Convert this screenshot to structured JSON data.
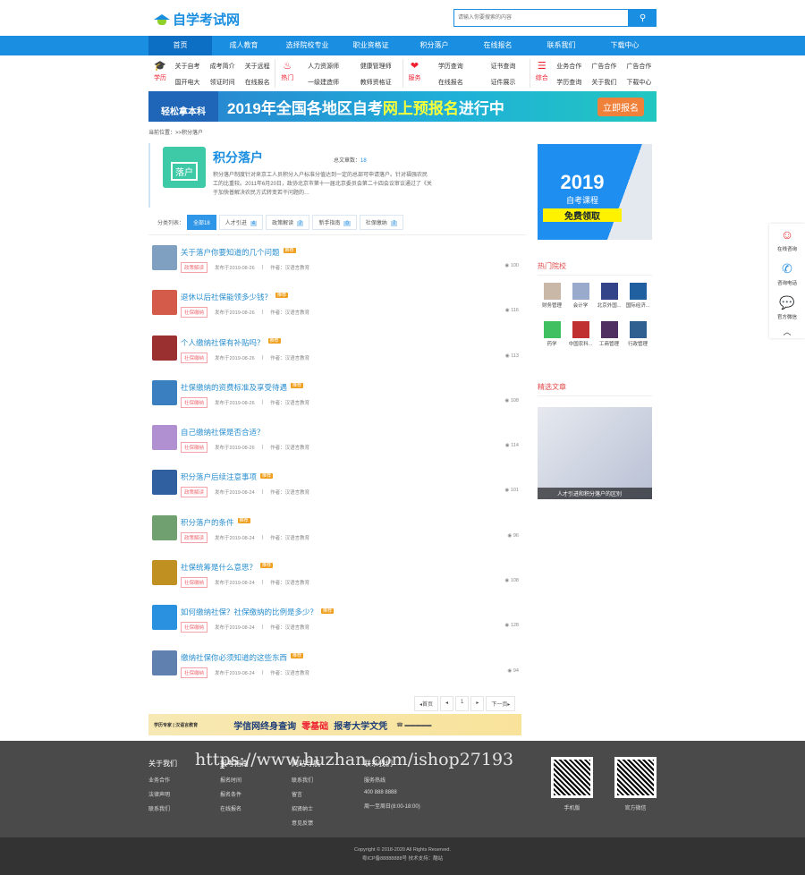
{
  "header": {
    "logo": "自学考试网",
    "search_placeholder": "请输入你要搜索的内容",
    "search_icon": "search-icon"
  },
  "nav": [
    "首页",
    "成人教育",
    "选择院校专业",
    "职业资格证",
    "积分落户",
    "在线报名",
    "联系我们",
    "下载中心"
  ],
  "subnav": [
    {
      "icon": "graduation-cap-icon",
      "label": "学历",
      "links": [
        "关于自考",
        "成考简介",
        "关于远程",
        "国开电大",
        "领证时间",
        "在线报名"
      ]
    },
    {
      "icon": "fire-icon",
      "label": "热门",
      "links": [
        "人力资源师",
        "健康管理师",
        "一级建造师",
        "教师资格证"
      ]
    },
    {
      "icon": "heart-icon",
      "label": "服务",
      "links": [
        "学历查询",
        "证书查询",
        "在线报名",
        "证件展示"
      ]
    },
    {
      "icon": "layers-icon",
      "label": "综合",
      "links": [
        "业务合作",
        "广告合作",
        "广告合作",
        "学历查询",
        "关于我们",
        "下载中心"
      ]
    }
  ],
  "banner": {
    "left": "轻松拿本科",
    "text": "2019年全国各地区自考",
    "highlight": "网上预报名",
    "text2": "进行中",
    "button": "立即报名"
  },
  "breadcrumb": "当前位置：>>积分落户",
  "category": {
    "badge": "落户",
    "title": "积分落户",
    "count_label": "总文章数：",
    "count": "18",
    "desc": "积分落户制度针对来京工人员积分入户标准分值达到一定的总部可申请落户。针对福强农民工的比重较。2011年6月20日，政协北京市第十一届北京委员会第二十四会议审议通过了《关于加快普解决农民方式转变若干问题的…"
  },
  "filter": {
    "label": "分类列表：",
    "tabs": [
      {
        "name": "全部",
        "count": "18"
      },
      {
        "name": "人才引进",
        "count": "4"
      },
      {
        "name": "政策解读",
        "count": "7"
      },
      {
        "name": "新手指南",
        "count": "0"
      },
      {
        "name": "社保缴纳",
        "count": "7"
      }
    ]
  },
  "articles": [
    {
      "title": "关于落户你要知道的几个问题",
      "badge": "推荐",
      "tag": "政策解读",
      "date": "发布于2019-08-26",
      "author": "作者：汉语言教育",
      "views": "100",
      "color": "#7fa0c0"
    },
    {
      "title": "退休以后社保能领多少钱？",
      "badge": "推荐",
      "tag": "社保缴纳",
      "date": "发布于2019-08-26",
      "author": "作者：汉语言教育",
      "views": "116",
      "color": "#d45a4a"
    },
    {
      "title": "个人缴纳社保有补贴吗？",
      "badge": "推荐",
      "tag": "社保缴纳",
      "date": "发布于2019-08-26",
      "author": "作者：汉语言教育",
      "views": "113",
      "color": "#9a3030"
    },
    {
      "title": "社保缴纳的资费标准及享受待遇",
      "badge": "推荐",
      "tag": "社保缴纳",
      "date": "发布于2019-08-26",
      "author": "作者：汉语言教育",
      "views": "108",
      "color": "#3a80c0"
    },
    {
      "title": "自己缴纳社保是否合适？",
      "badge": "",
      "tag": "社保缴纳",
      "date": "发布于2019-08-26",
      "author": "作者：汉语言教育",
      "views": "114",
      "color": "#b090d0"
    },
    {
      "title": "积分落户后续注意事项",
      "badge": "推荐",
      "tag": "政策解读",
      "date": "发布于2019-08-24",
      "author": "作者：汉语言教育",
      "views": "101",
      "color": "#3060a0"
    },
    {
      "title": "积分落户的条件",
      "badge": "推荐",
      "tag": "政策解读",
      "date": "发布于2019-08-24",
      "author": "作者：汉语言教育",
      "views": "96",
      "color": "#70a070"
    },
    {
      "title": "社保统筹是什么意思？",
      "badge": "推荐",
      "tag": "社保缴纳",
      "date": "发布于2019-08-24",
      "author": "作者：汉语言教育",
      "views": "108",
      "color": "#c09020"
    },
    {
      "title": "如何缴纳社保？社保缴纳的比例是多少？",
      "badge": "推荐",
      "tag": "社保缴纳",
      "date": "发布于2019-08-24",
      "author": "作者：汉语言教育",
      "views": "128",
      "color": "#2a90e0"
    },
    {
      "title": "缴纳社保你必须知道的这些东西",
      "badge": "推荐",
      "tag": "社保缴纳",
      "date": "发布于2019-08-24",
      "author": "作者：汉语言教育",
      "views": "94",
      "color": "#6080b0"
    }
  ],
  "pager": [
    "◂首页",
    "◂",
    "1",
    "▸",
    "下一页▸"
  ],
  "ad": {
    "small": "学历专家 | 汉语言教育",
    "t1": "学信网终身查询",
    "t2": "零基础",
    "t3": "报考大学文凭"
  },
  "sidebar": {
    "promo": {
      "year": "2019",
      "sub": "自考课程",
      "btn": "免费领取"
    },
    "hot_title": "热门院校",
    "schools": [
      {
        "name": "财务管理",
        "color": "#c9b8a8"
      },
      {
        "name": "会计学",
        "color": "#9ac"
      },
      {
        "name": "北京外国...",
        "color": "#334488"
      },
      {
        "name": "国际经济...",
        "color": "#2060a0"
      },
      {
        "name": "药学",
        "color": "#40c060"
      },
      {
        "name": "中国农科...",
        "color": "#c03030"
      },
      {
        "name": "工商管理",
        "color": "#503060"
      },
      {
        "name": "行政管理",
        "color": "#306090"
      }
    ],
    "articles_title": "精选文章",
    "featured_caption": "人才引进和积分落户的区别"
  },
  "float": [
    {
      "icon": "service-avatar-icon",
      "label": "在线咨询"
    },
    {
      "icon": "phone-icon",
      "label": "咨询电话"
    },
    {
      "icon": "wechat-icon",
      "label": "官方微信"
    }
  ],
  "footer": {
    "cols": [
      {
        "title": "关于我们",
        "links": [
          "业务合作",
          "法律声明",
          "联系我们"
        ]
      },
      {
        "title": "报考指南",
        "links": [
          "报名时间",
          "报名条件",
          "在线报名"
        ]
      },
      {
        "title": "网站导航",
        "links": [
          "联系我们",
          "留言",
          "招贤纳士",
          "意见反馈"
        ]
      },
      {
        "title": "联系我们",
        "links": [
          "服务热线",
          "400 888 8888",
          "周一至周日(8:00-18:00)"
        ]
      }
    ],
    "qr1": "手机版",
    "qr2": "官方微信",
    "watermark": "https://www.huzhan.com/ishop27193",
    "copyright": "Copyright © 2018-2020 All Rights Reserved.",
    "icp": "粤ICP备88888888号 技术支持：酷站"
  }
}
